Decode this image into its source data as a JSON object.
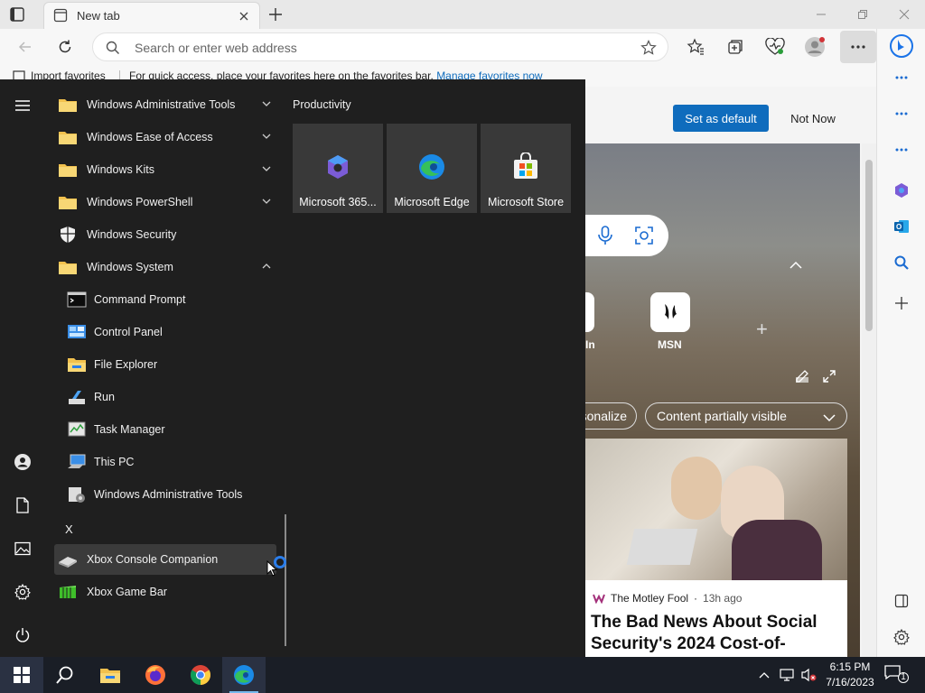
{
  "browser": {
    "tab_title": "New tab",
    "address_placeholder": "Search or enter web address",
    "favorites_bar": {
      "import_label": "Import favorites",
      "hint_text": "For quick access, place your favorites here on the favorites bar.",
      "hint_link": "Manage favorites now"
    }
  },
  "page": {
    "set_default_label": "Set as default",
    "not_now_label": "Not Now",
    "quick_links": [
      {
        "label": "In"
      },
      {
        "label": "MSN"
      }
    ],
    "personalize_chip": "sonalize",
    "content_chip": "Content partially visible",
    "news": {
      "source": "The Motley Fool",
      "time": "13h ago",
      "title": "The Bad News About Social Security's 2024 Cost-of-"
    }
  },
  "start_menu": {
    "apps": [
      {
        "label": "Windows Administrative Tools",
        "icon": "folder-icon",
        "expand": "down"
      },
      {
        "label": "Windows Ease of Access",
        "icon": "folder-icon",
        "expand": "down"
      },
      {
        "label": "Windows Kits",
        "icon": "folder-icon",
        "expand": "down"
      },
      {
        "label": "Windows PowerShell",
        "icon": "folder-icon",
        "expand": "down"
      },
      {
        "label": "Windows Security",
        "icon": "shield-icon"
      },
      {
        "label": "Windows System",
        "icon": "folder-icon",
        "expand": "up"
      },
      {
        "label": "Command Prompt",
        "icon": "cmd-icon",
        "sub": true
      },
      {
        "label": "Control Panel",
        "icon": "control-panel-icon",
        "sub": true
      },
      {
        "label": "File Explorer",
        "icon": "file-explorer-icon",
        "sub": true
      },
      {
        "label": "Run",
        "icon": "run-icon",
        "sub": true
      },
      {
        "label": "Task Manager",
        "icon": "task-manager-icon",
        "sub": true
      },
      {
        "label": "This PC",
        "icon": "this-pc-icon",
        "sub": true
      },
      {
        "label": "Windows Administrative Tools",
        "icon": "admin-tools-icon",
        "sub": true
      }
    ],
    "letter_x": "X",
    "x_apps": [
      {
        "label": "Xbox Console Companion",
        "icon": "xbox-console-icon"
      },
      {
        "label": "Xbox Game Bar",
        "icon": "xbox-game-bar-icon"
      }
    ],
    "group_title": "Productivity",
    "tiles": [
      {
        "label": "Microsoft 365...",
        "icon": "microsoft-365-icon"
      },
      {
        "label": "Microsoft Edge",
        "icon": "edge-icon"
      },
      {
        "label": "Microsoft Store",
        "icon": "store-icon"
      }
    ]
  },
  "taskbar": {
    "time": "6:15 PM",
    "date": "7/16/2023",
    "notification_count": "1"
  },
  "colors": {
    "start_bg": "#1f1f1f",
    "accent": "#0f6cbd",
    "taskbar_bg": "#1a1e26"
  }
}
